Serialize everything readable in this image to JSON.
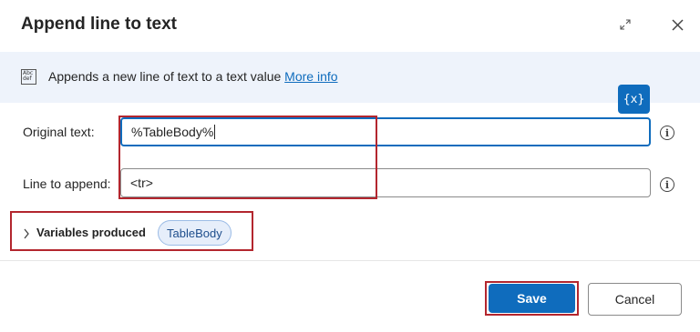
{
  "dialog": {
    "title": "Append line to text"
  },
  "info": {
    "icon": "abc-def-text-icon",
    "icon_glyph_line1": "Abc",
    "icon_glyph_line2": "def",
    "description": "Appends a new line of text to a text value",
    "link_label": "More info"
  },
  "fields": {
    "original_text": {
      "label": "Original text:",
      "value": "%TableBody%"
    },
    "line_to_append": {
      "label": "Line to append:",
      "value": "<tr>"
    }
  },
  "variable_button": {
    "label": "{x}"
  },
  "variables_produced": {
    "label": "Variables produced",
    "variable": "TableBody"
  },
  "footer": {
    "save_label": "Save",
    "cancel_label": "Cancel"
  },
  "colors": {
    "accent": "#0f6cbd",
    "info_bar": "#eef3fb",
    "highlight_box": "#b3262e"
  }
}
